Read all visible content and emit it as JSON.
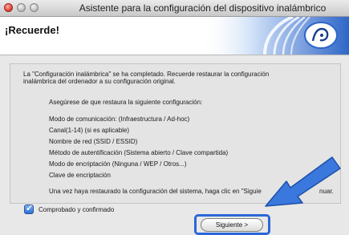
{
  "window": {
    "title": "Asistente para la configuración del dispositivo inalámbrico"
  },
  "header": {
    "title": "¡Recuerde!"
  },
  "body": {
    "intro_line1": "La \"Configuración inalámbrica\" se ha completado. Recuerde restaurar la configuración",
    "intro_line2": "inalámbrica del ordenador a su configuración original.",
    "ensure": "Asegúrese de que restaura la siguiente configuración:",
    "items": [
      "Modo de comunicación: (Infraestructura / Ad-hoc)",
      "Canal(1-14) (si es aplicable)",
      "Nombre de red (SSID / ESSID)",
      "Método de autentificación (Sistema abierto / Clave compartida)",
      "Modo de encriptación (Ninguna / WEP / Otros...)",
      "Clave de encriptación"
    ],
    "footer": "Una vez haya restaurado la configuración del sistema, haga clic en \"Siguie",
    "footer_tail": "nuar."
  },
  "checkbox": {
    "label": "Comprobado y confirmado",
    "checked": true
  },
  "buttons": {
    "next": "Siguiente >"
  },
  "colors": {
    "accent": "#2b67d8",
    "swoosh": "#3f77d6"
  },
  "icons": [
    "close-button",
    "minimize-button",
    "zoom-button",
    "wireless-logo-icon",
    "checkmark-icon",
    "pointer-arrow-icon"
  ]
}
